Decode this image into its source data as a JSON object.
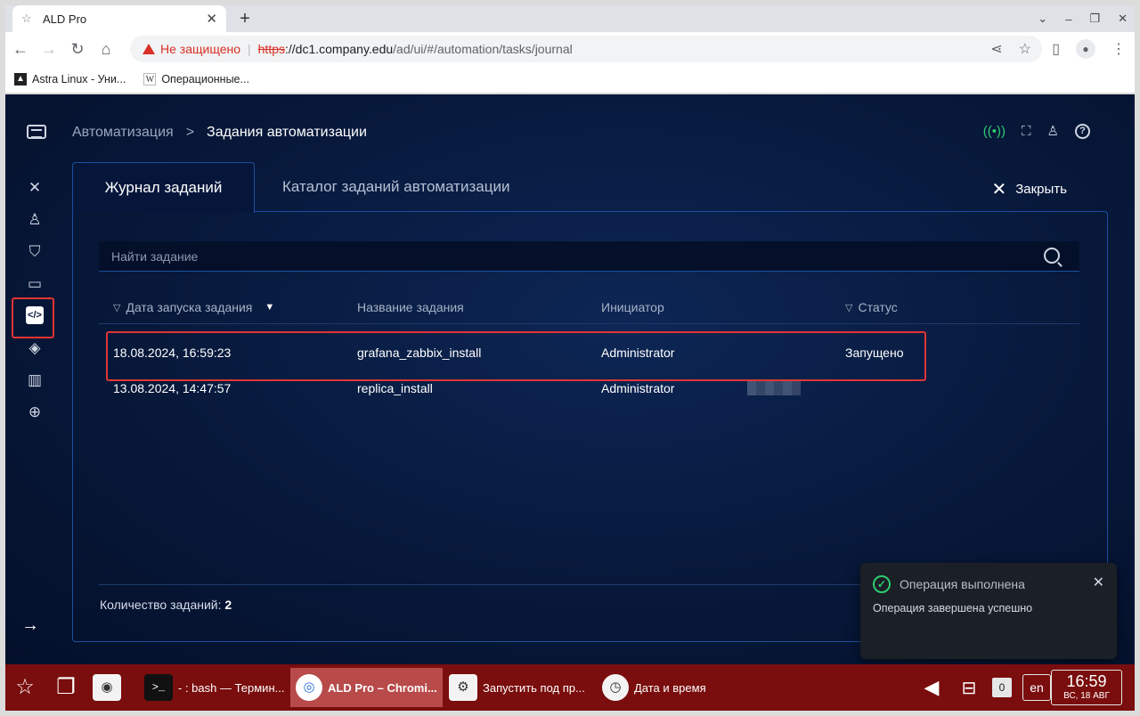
{
  "browser": {
    "tab_title": "ALD Pro",
    "security_label": "Не защищено",
    "url_scheme": "https",
    "url_host": "://dc1.company.edu",
    "url_path": "/ad/ui/#/automation/tasks/journal",
    "bookmarks": [
      "Astra Linux - Уни...",
      "Операционные..."
    ]
  },
  "app": {
    "breadcrumb": {
      "parent": "Автоматизация",
      "separator": ">",
      "current": "Задания автоматизации"
    },
    "tabs": {
      "active": "Журнал заданий",
      "inactive": "Каталог заданий автоматизации"
    },
    "close_label": "Закрыть",
    "search_placeholder": "Найти задание",
    "columns": {
      "date": "Дата запуска задания",
      "name": "Название задания",
      "initiator": "Инициатор",
      "status": "Статус"
    },
    "rows": [
      {
        "date": "18.08.2024, 16:59:23",
        "name": "grafana_zabbix_install",
        "initiator": "Administrator",
        "status": "Запущено"
      },
      {
        "date": "13.08.2024, 14:47:57",
        "name": "replica_install",
        "initiator": "Administrator",
        "status": ""
      }
    ],
    "count_label": "Количество заданий:",
    "count_value": "2",
    "highlight_color": "#e03535"
  },
  "toast": {
    "title": "Операция выполнена",
    "message": "Операция завершена успешно"
  },
  "taskbar": {
    "items": [
      "- : bash — Термин...",
      "ALD Pro – Chromi...",
      "Запустить под пр...",
      "Дата и время"
    ],
    "zero_badge": "0",
    "lang": "en",
    "time": "16:59",
    "date": "ВС, 18 АВГ"
  }
}
